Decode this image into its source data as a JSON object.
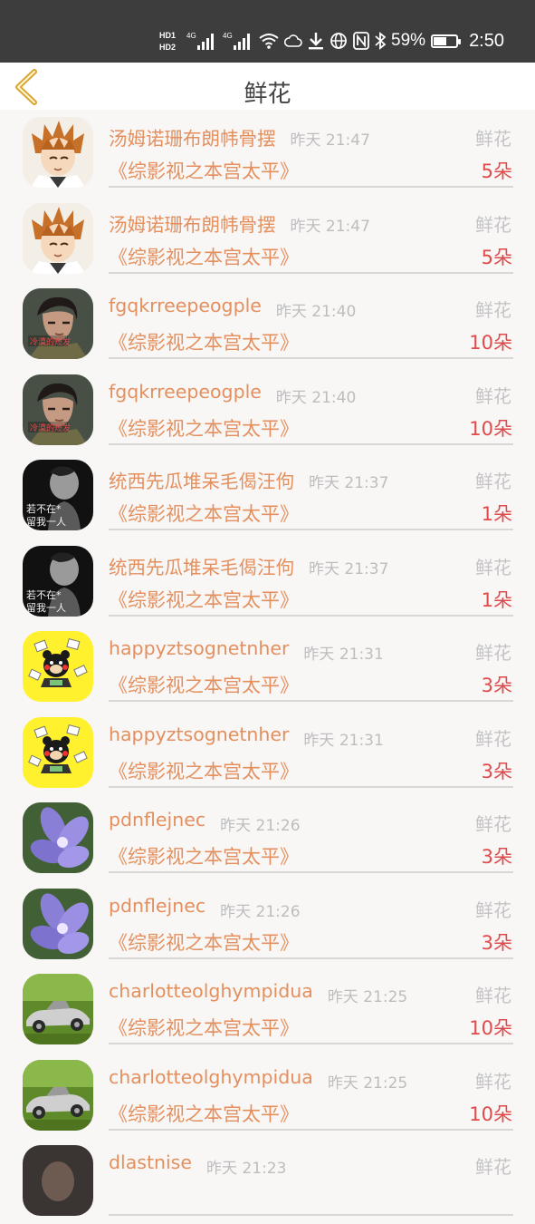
{
  "status_bar": {
    "network_labels": [
      "HD1",
      "HD2",
      "4G",
      "4G"
    ],
    "battery_percent": "59%",
    "battery_level": 0.59,
    "time": "2:50",
    "icons": [
      "signal-icon",
      "wifi-icon",
      "cloud-icon",
      "download-icon",
      "nfc-icon",
      "bluetooth-icon",
      "globe-icon",
      "battery-icon"
    ]
  },
  "header": {
    "title": "鲜花",
    "back_icon": "chevron-left-icon"
  },
  "records": [
    {
      "user": "汤姆诺珊布朗帏骨摆",
      "time": "昨天 21:47",
      "gift": "鲜花",
      "book": "《综影视之本宫太平》",
      "count": "5朵",
      "avatar": "anime-boy"
    },
    {
      "user": "汤姆诺珊布朗帏骨摆",
      "time": "昨天 21:47",
      "gift": "鲜花",
      "book": "《综影视之本宫太平》",
      "count": "5朵",
      "avatar": "anime-boy"
    },
    {
      "user": "fgqkrreepeogple",
      "time": "昨天 21:40",
      "gift": "鲜花",
      "book": "《综影视之本宫太平》",
      "count": "10朵",
      "avatar": "man-portrait"
    },
    {
      "user": "fgqkrreepeogple",
      "time": "昨天 21:40",
      "gift": "鲜花",
      "book": "《综影视之本宫太平》",
      "count": "10朵",
      "avatar": "man-portrait"
    },
    {
      "user": "统西先瓜堆呆毛偈汪佝",
      "time": "昨天 21:37",
      "gift": "鲜花",
      "book": "《综影视之本宫太平》",
      "count": "1朵",
      "avatar": "bw-text"
    },
    {
      "user": "统西先瓜堆呆毛偈汪佝",
      "time": "昨天 21:37",
      "gift": "鲜花",
      "book": "《综影视之本宫太平》",
      "count": "1朵",
      "avatar": "bw-text"
    },
    {
      "user": "happyztsognetnher",
      "time": "昨天 21:31",
      "gift": "鲜花",
      "book": "《综影视之本宫太平》",
      "count": "3朵",
      "avatar": "yellow-bear"
    },
    {
      "user": "happyztsognetnher",
      "time": "昨天 21:31",
      "gift": "鲜花",
      "book": "《综影视之本宫太平》",
      "count": "3朵",
      "avatar": "yellow-bear"
    },
    {
      "user": "pdnflejnec",
      "time": "昨天 21:26",
      "gift": "鲜花",
      "book": "《综影视之本宫太平》",
      "count": "3朵",
      "avatar": "purple-flower"
    },
    {
      "user": "pdnflejnec",
      "time": "昨天 21:26",
      "gift": "鲜花",
      "book": "《综影视之本宫太平》",
      "count": "3朵",
      "avatar": "purple-flower"
    },
    {
      "user": "charlotteolghympidua",
      "time": "昨天 21:25",
      "gift": "鲜花",
      "book": "《综影视之本宫太平》",
      "count": "10朵",
      "avatar": "vintage-car"
    },
    {
      "user": "charlotteolghympidua",
      "time": "昨天 21:25",
      "gift": "鲜花",
      "book": "《综影视之本宫太平》",
      "count": "10朵",
      "avatar": "vintage-car"
    },
    {
      "user": "dlastnise",
      "time": "昨天 21:23",
      "gift": "鲜花",
      "book": "",
      "count": "",
      "avatar": "dark-portrait"
    }
  ],
  "avatar_text": {
    "man-portrait": "冷漠的短发",
    "bw-text": [
      "若不在*",
      "留我一人"
    ]
  },
  "colors": {
    "username": "#e3905e",
    "count": "#e04a4a",
    "muted": "#bdbdbd",
    "accent_back": "#d8a32a"
  }
}
